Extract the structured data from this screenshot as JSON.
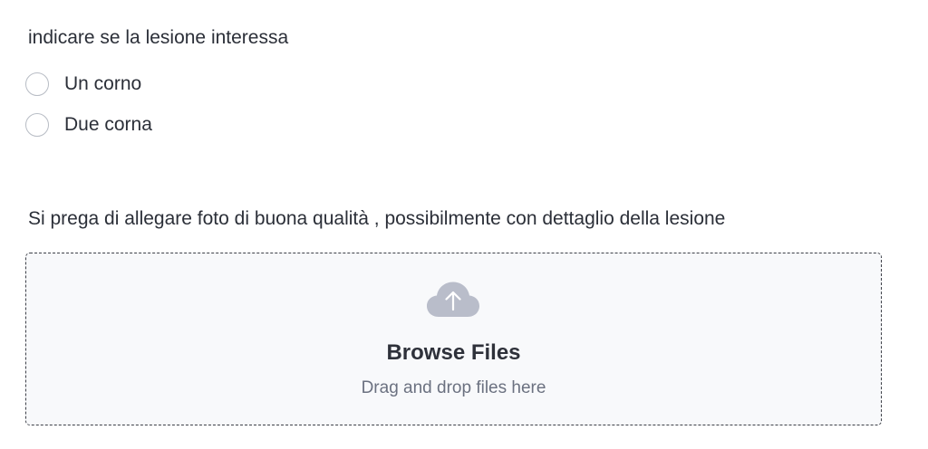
{
  "question": {
    "label": "indicare se la lesione interessa",
    "options": [
      {
        "label": "Un corno",
        "selected": false
      },
      {
        "label": "Due corna",
        "selected": false
      }
    ]
  },
  "upload": {
    "label": "Si prega di allegare foto di buona qualità , possibilmente con dettaglio della lesione",
    "icon": "cloud-upload-icon",
    "title": "Browse Files",
    "subtitle": "Drag and drop files here"
  },
  "colors": {
    "text": "#2b2f38",
    "muted_text": "#6b7180",
    "radio_border": "#b7bcc4",
    "dropzone_border": "#3d4048",
    "dropzone_bg": "#f8f9fb",
    "icon": "#b9bdca"
  }
}
